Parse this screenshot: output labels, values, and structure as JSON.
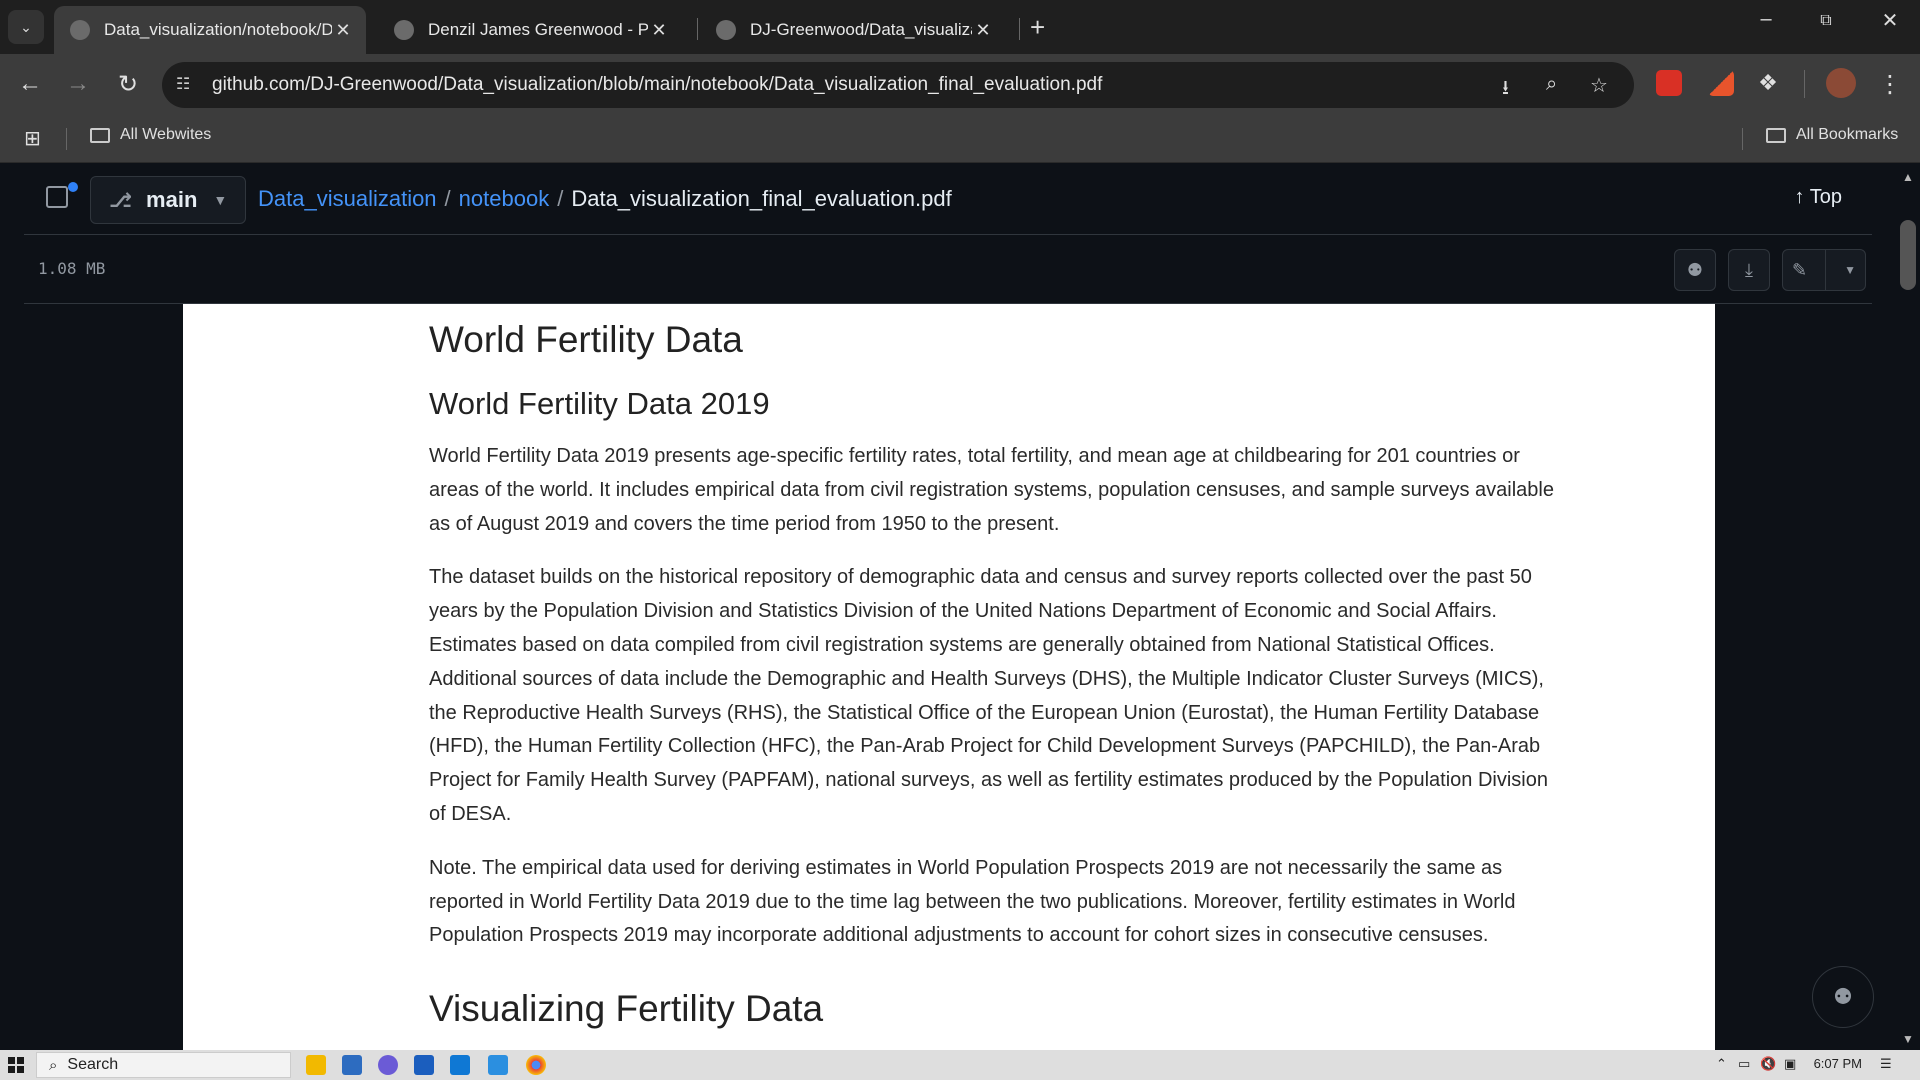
{
  "browser": {
    "tabs": [
      {
        "title": "Data_visualization/notebook/D",
        "active": true
      },
      {
        "title": "Denzil James Greenwood - Port",
        "active": false
      },
      {
        "title": "DJ-Greenwood/Data_visualizati",
        "active": false
      }
    ],
    "url": "github.com/DJ-Greenwood/Data_visualization/blob/main/notebook/Data_visualization_final_evaluation.pdf",
    "bookmarks": {
      "left": "All Webwites",
      "right": "All Bookmarks"
    }
  },
  "repo": {
    "branch": "main",
    "breadcrumb": {
      "repo": "Data_visualization",
      "folder": "notebook",
      "file": "Data_visualization_final_evaluation.pdf",
      "sep": "/"
    },
    "top_label": "Top",
    "file_size": "1.08 MB"
  },
  "pdf": {
    "heading1": "World Fertility Data",
    "heading2": "World Fertility Data 2019",
    "para1": "World Fertility Data 2019 presents age-specific fertility rates, total fertility, and mean age at childbearing for 201 countries or areas of the world. It includes empirical data from civil registration systems, population censuses, and sample surveys available as of August 2019 and covers the time period from 1950 to the present.",
    "para2": "The dataset builds on the historical repository of demographic data and census and survey reports collected over the past 50 years by the Population Division and Statistics Division of the United Nations Department of Economic and Social Affairs. Estimates based on data compiled from civil registration systems are generally obtained from National Statistical Offices. Additional sources of data include the Demographic and Health Surveys (DHS), the Multiple Indicator Cluster Surveys (MICS), the Reproductive Health Surveys (RHS), the Statistical Office of the European Union (Eurostat), the Human Fertility Database (HFD), the Human Fertility Collection (HFC), the Pan-Arab Project for Child Development Surveys (PAPCHILD), the Pan-Arab Project for Family Health Survey (PAPFAM), national surveys, as well as fertility estimates produced by the Population Division of DESA.",
    "para3": "Note. The empirical data used for deriving estimates in World Population Prospects 2019 are not necessarily the same as reported in World Fertility Data 2019 due to the time lag between the two publications. Moreover, fertility estimates in World Population Prospects 2019 may incorporate additional adjustments to account for cohort sizes in consecutive censuses.",
    "heading_next": "Visualizing Fertility Data"
  },
  "taskbar": {
    "search_label": "Search",
    "time": "6:07 PM"
  },
  "colors": {
    "link": "#4493f8",
    "github_bg": "#0d1117",
    "chrome_bg": "#3c3c3c"
  }
}
